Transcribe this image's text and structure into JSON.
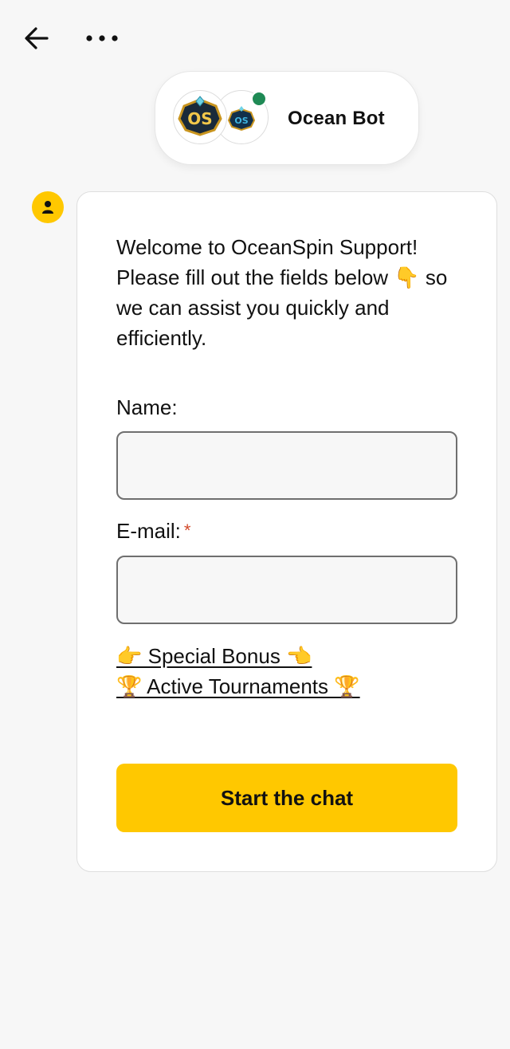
{
  "header": {
    "back_icon": "arrow-left-icon",
    "more_icon": "more-horizontal-icon"
  },
  "bot": {
    "name": "Ocean Bot",
    "status": "online",
    "status_color": "#1f8a55",
    "logo_1_text": "OS",
    "logo_2_text": "OS"
  },
  "message": {
    "user_icon": "user-icon",
    "welcome_text": "Welcome to OceanSpin Support! Please fill out the fields below 👇 so we can assist you quickly and efficiently."
  },
  "form": {
    "name_label": "Name:",
    "name_value": "",
    "email_label": "E-mail:",
    "email_required_mark": "*",
    "email_value": "",
    "links": [
      {
        "label": "👉 Special Bonus 👈"
      },
      {
        "label": "🏆 Active Tournaments 🏆"
      }
    ],
    "submit_label": "Start the chat"
  },
  "colors": {
    "accent": "#ffc800",
    "background": "#f7f7f7",
    "required": "#d24a2b"
  }
}
